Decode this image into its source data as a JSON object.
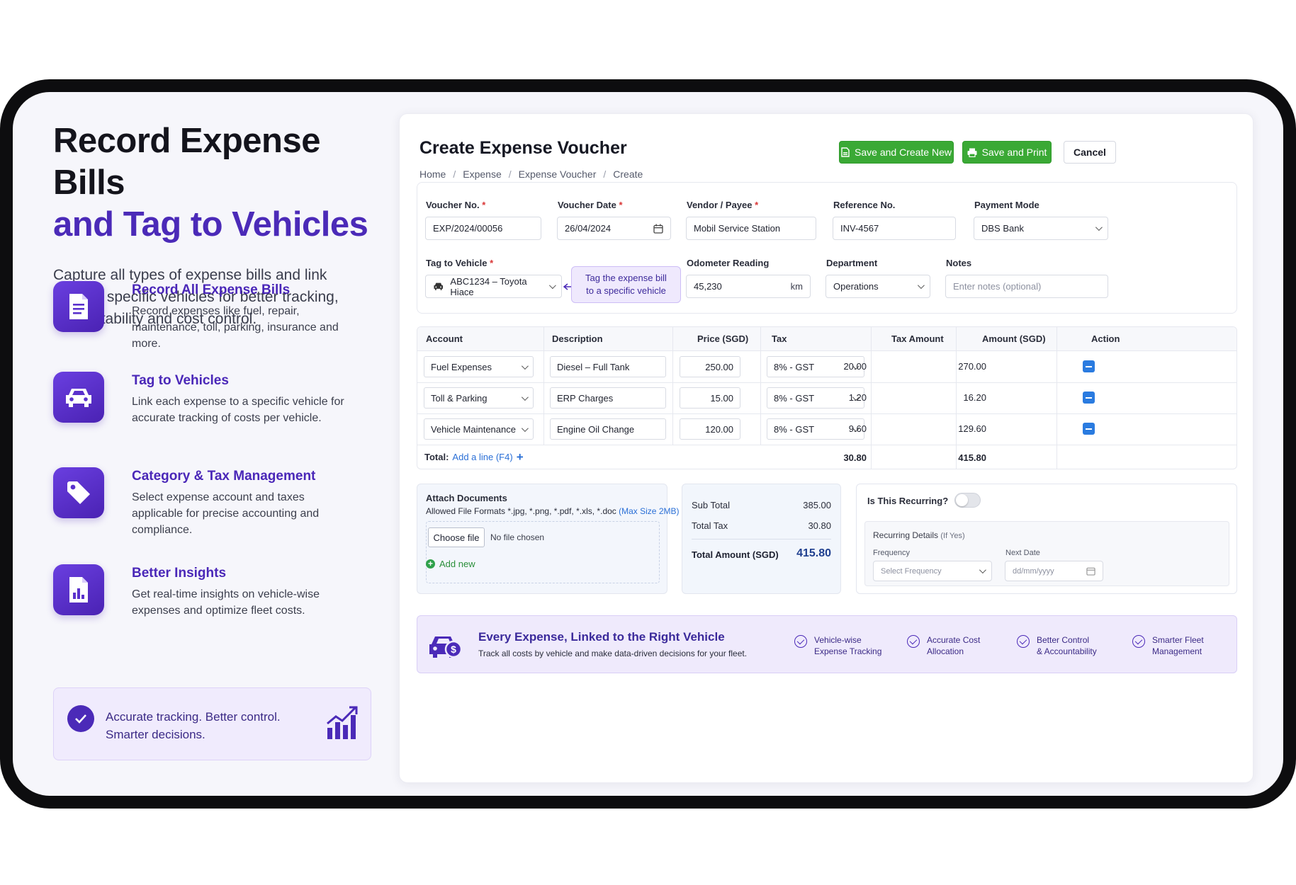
{
  "hero": {
    "title_line1": "Record Expense Bills",
    "title_line2": "and Tag to Vehicles",
    "subtitle": "Capture all types of expense bills and link them to specific vehicles for better tracking, accountability and cost control."
  },
  "features": [
    {
      "title": "Record All Expense Bills",
      "desc": "Record expenses like fuel, repair, maintenance, toll, parking, insurance and more.",
      "icon": "document-icon"
    },
    {
      "title": "Tag to Vehicles",
      "desc": "Link each expense to a specific vehicle for accurate tracking of costs per vehicle.",
      "icon": "car-icon"
    },
    {
      "title": "Category & Tax Management",
      "desc": "Select expense account and taxes applicable for precise accounting and compliance.",
      "icon": "tag-icon"
    },
    {
      "title": "Better Insights",
      "desc": "Get real-time insights on vehicle-wise expenses and optimize fleet costs.",
      "icon": "report-icon"
    }
  ],
  "accent": {
    "line1": "Accurate tracking. Better control.",
    "line2": "Smarter decisions."
  },
  "form": {
    "title": "Create Expense Voucher",
    "breadcrumb": [
      "Home",
      "Expense",
      "Expense Voucher",
      "Create"
    ],
    "buttons": {
      "save_new": "Save and Create New",
      "save_print": "Save and Print",
      "cancel": "Cancel"
    },
    "voucher_no": {
      "label": "Voucher No.",
      "value": "EXP/2024/00056"
    },
    "voucher_date": {
      "label": "Voucher Date",
      "value": "26/04/2024"
    },
    "vendor": {
      "label": "Vendor / Payee",
      "value": "Mobil Service Station"
    },
    "reference": {
      "label": "Reference No.",
      "value": "INV-4567"
    },
    "payment_mode": {
      "label": "Payment Mode",
      "value": "DBS Bank"
    },
    "vehicle": {
      "label": "Tag to Vehicle",
      "value": "ABC1234 – Toyota Hiace"
    },
    "tooltip": {
      "line1": "Tag the expense bill",
      "line2": "to a specific vehicle"
    },
    "odometer": {
      "label": "Odometer Reading",
      "value": "45,230",
      "unit": "km"
    },
    "department": {
      "label": "Department",
      "value": "Operations"
    },
    "notes": {
      "label": "Notes",
      "placeholder": "Enter notes (optional)"
    }
  },
  "table": {
    "headers": [
      "Account",
      "Description",
      "Price (SGD)",
      "Tax",
      "Tax Amount",
      "Amount (SGD)",
      "Action"
    ],
    "rows": [
      {
        "account": "Fuel Expenses",
        "desc": "Diesel – Full Tank",
        "price": "250.00",
        "tax": "8% - GST",
        "tax_amount": "20.00",
        "amount": "270.00"
      },
      {
        "account": "Toll & Parking",
        "desc": "ERP Charges",
        "price": "15.00",
        "tax": "8% - GST",
        "tax_amount": "1.20",
        "amount": "16.20"
      },
      {
        "account": "Vehicle Maintenance",
        "desc": "Engine Oil Change",
        "price": "120.00",
        "tax": "8% - GST",
        "tax_amount": "9.60",
        "amount": "129.60"
      }
    ],
    "total_label": "Total:",
    "add_line": "Add a line (F4)",
    "total_tax": "30.80",
    "total_amount": "415.80"
  },
  "attach": {
    "title": "Attach Documents",
    "formats": "Allowed File Formats *.jpg, *.png, *.pdf, *.xls, *.doc",
    "max_size": "(Max Size 2MB)",
    "choose": "Choose file",
    "no_file": "No file chosen",
    "add_new": "Add new"
  },
  "summary": {
    "sub_total_label": "Sub Total",
    "sub_total": "385.00",
    "total_tax_label": "Total Tax",
    "total_tax": "30.80",
    "total_label": "Total Amount (SGD)",
    "total": "415.80"
  },
  "recurring": {
    "question": "Is This Recurring?",
    "details_title": "Recurring Details",
    "details_hint": "(If Yes)",
    "frequency_label": "Frequency",
    "frequency_placeholder": "Select Frequency",
    "next_date_label": "Next Date",
    "next_date_placeholder": "dd/mm/yyyy",
    "enabled": false
  },
  "banner": {
    "title": "Every Expense, Linked to the Right Vehicle",
    "subtitle": "Track all costs by vehicle and make data-driven decisions for your fleet.",
    "items": [
      {
        "l1": "Vehicle-wise",
        "l2": "Expense Tracking"
      },
      {
        "l1": "Accurate Cost",
        "l2": "Allocation"
      },
      {
        "l1": "Better Control",
        "l2": "& Accountability"
      },
      {
        "l1": "Smarter Fleet",
        "l2": "Management"
      }
    ]
  },
  "colors": {
    "brand": "#4b2ab8",
    "green": "#3aa935",
    "link": "#2a6fd6"
  }
}
